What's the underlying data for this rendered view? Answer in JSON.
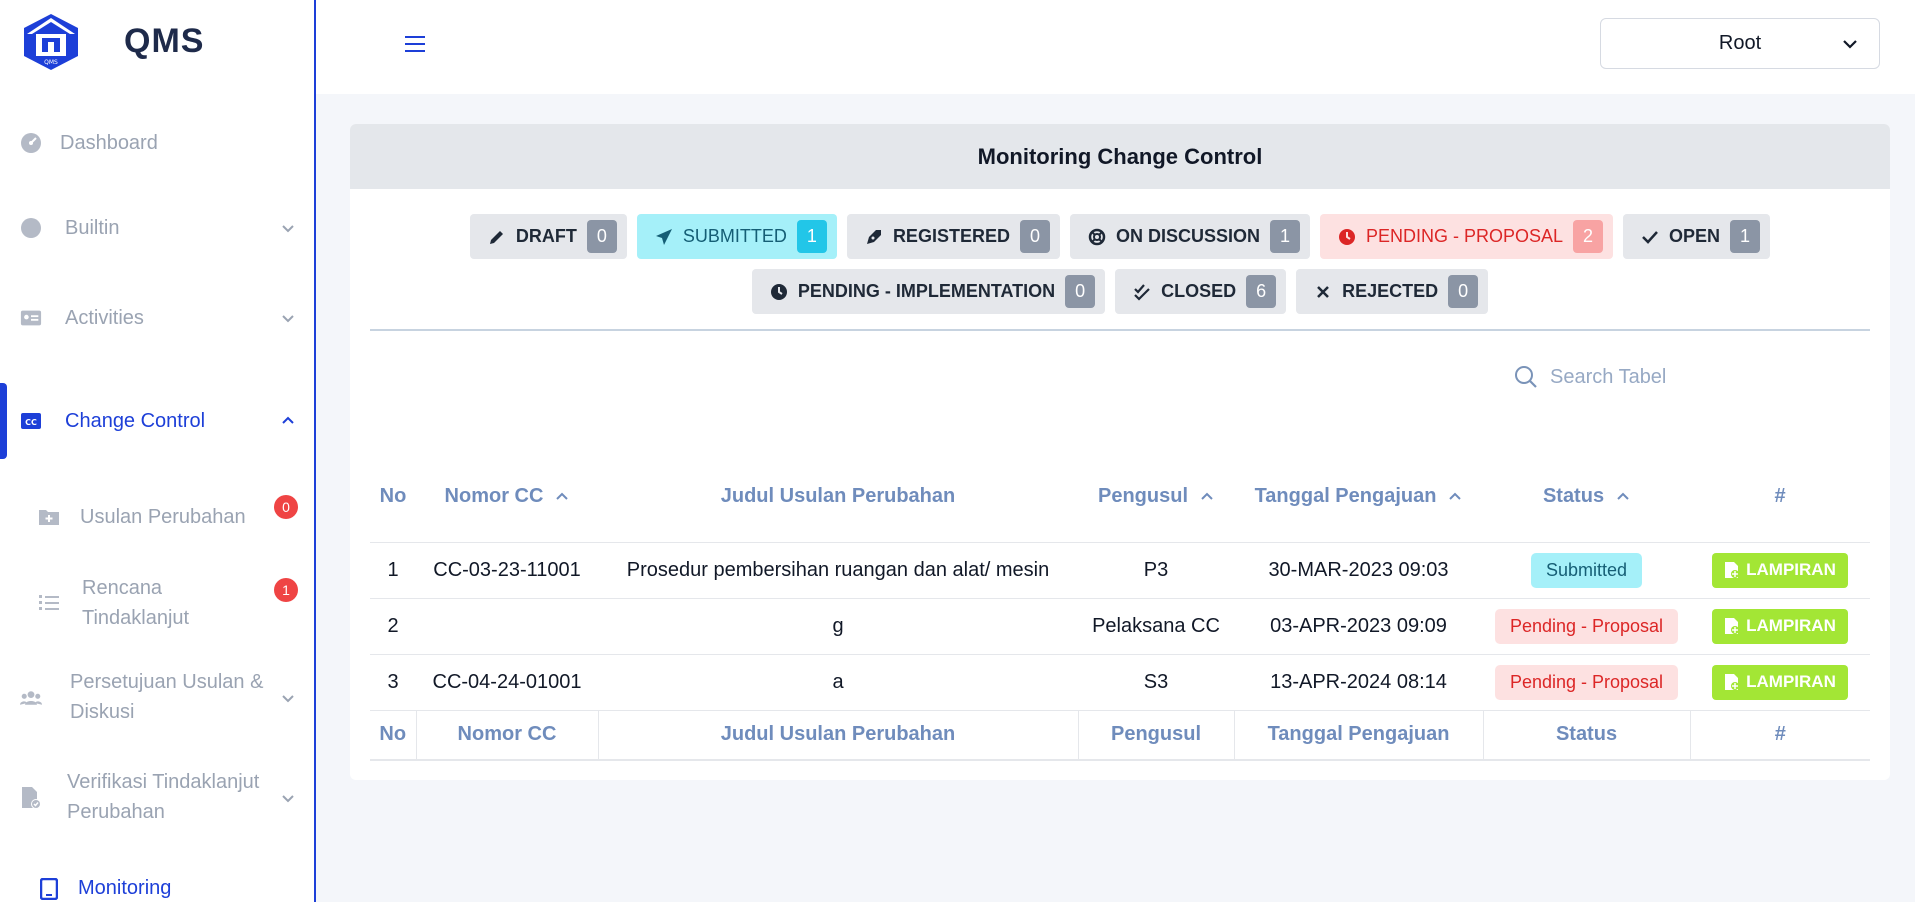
{
  "app": {
    "name": "QMS"
  },
  "header": {
    "user": "Root"
  },
  "sidebar": {
    "dashboard": "Dashboard",
    "builtin": "Builtin",
    "activities": "Activities",
    "change_control": "Change Control",
    "usulan": {
      "label": "Usulan Perubahan",
      "badge": "0"
    },
    "rencana": {
      "label_1": "Rencana",
      "label_2": "Tindaklanjut",
      "badge": "1"
    },
    "persetujuan": {
      "label_1": "Persetujuan Usulan &",
      "label_2": "Diskusi"
    },
    "verifikasi": {
      "label_1": "Verifikasi Tindaklanjut",
      "label_2": "Perubahan"
    },
    "monitoring": "Monitoring"
  },
  "card": {
    "title": "Monitoring Change Control"
  },
  "filters": [
    {
      "label": "DRAFT",
      "count": "0"
    },
    {
      "label": "SUBMITTED",
      "count": "1"
    },
    {
      "label": "REGISTERED",
      "count": "0"
    },
    {
      "label": "ON DISCUSSION",
      "count": "1"
    },
    {
      "label": "PENDING - PROPOSAL",
      "count": "2"
    },
    {
      "label": "OPEN",
      "count": "1"
    },
    {
      "label": "PENDING - IMPLEMENTATION",
      "count": "0"
    },
    {
      "label": "CLOSED",
      "count": "6"
    },
    {
      "label": "REJECTED",
      "count": "0"
    }
  ],
  "search": {
    "placeholder": "Search Tabel"
  },
  "table": {
    "headers": [
      "No",
      "Nomor CC",
      "Judul Usulan Perubahan",
      "Pengusul",
      "Tanggal Pengajuan",
      "Status",
      "#"
    ],
    "rows": [
      {
        "no": "1",
        "nomor": "CC-03-23-11001",
        "judul": "Prosedur pembersihan ruangan dan alat/ mesin",
        "pengusul": "P3",
        "tanggal": "30-MAR-2023 09:03",
        "status": "Submitted",
        "action": "LAMPIRAN"
      },
      {
        "no": "2",
        "nomor": "",
        "judul": "g",
        "pengusul": "Pelaksana CC",
        "tanggal": "03-APR-2023 09:09",
        "status": "Pending - Proposal",
        "action": "LAMPIRAN"
      },
      {
        "no": "3",
        "nomor": "CC-04-24-01001",
        "judul": "a",
        "pengusul": "S3",
        "tanggal": "13-APR-2024 08:14",
        "status": "Pending - Proposal",
        "action": "LAMPIRAN"
      }
    ]
  },
  "colors": {
    "primary": "#1d3fd8",
    "submitted_bg": "#a5f0f9",
    "pending_bg": "#fde1e1",
    "lampiran": "#a3e635"
  }
}
